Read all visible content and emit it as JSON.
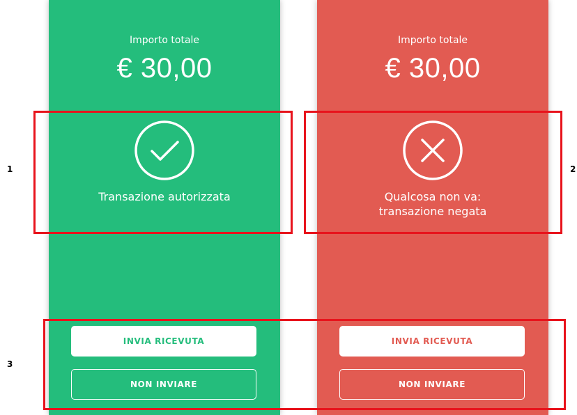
{
  "panels": [
    {
      "variant": "success",
      "background": "#24bd7c",
      "amount_label": "Importo totale",
      "amount_value": "€ 30,00",
      "status_icon": "check-circle-icon",
      "status_lines": [
        "Transazione autorizzata"
      ],
      "primary_button": "INVIA RICEVUTA",
      "secondary_button": "NON INVIARE"
    },
    {
      "variant": "failure",
      "background": "#e25b52",
      "amount_label": "Importo totale",
      "amount_value": "€ 30,00",
      "status_icon": "x-circle-icon",
      "status_lines": [
        "Qualcosa non va:",
        "transazione negata"
      ],
      "primary_button": "INVIA RICEVUTA",
      "secondary_button": "NON INVIARE"
    }
  ],
  "annotations": {
    "highlight_color": "#e8131c",
    "markers": [
      "1",
      "2",
      "3"
    ]
  }
}
